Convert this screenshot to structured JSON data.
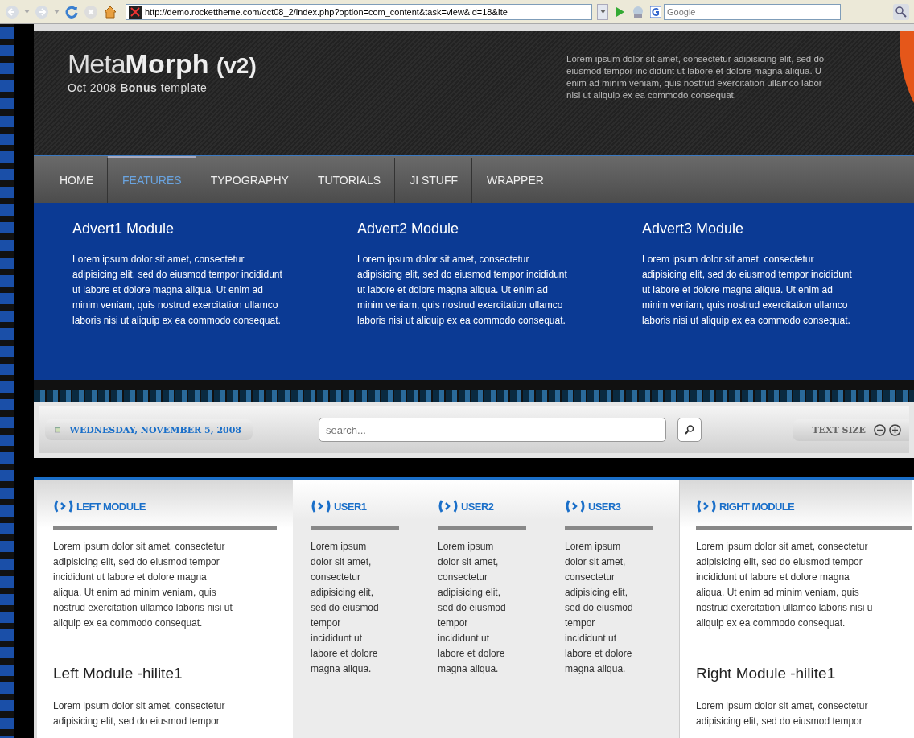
{
  "browser": {
    "address": "http://demo.rockettheme.com/oct08_2/index.php?option=com_content&task=view&id=18&Ite",
    "search_placeholder": "Google"
  },
  "header": {
    "logo_light": "Meta",
    "logo_bold": "Morph",
    "logo_version": "(v2)",
    "tagline": "Oct 2008 **Bonus** template",
    "intro_lines": [
      "Lorem ipsum dolor sit amet, consectetur adipisicing elit, sed do",
      "eiusmod tempor incididunt ut labore et dolore magna aliqua. U",
      "enim ad minim veniam, quis nostrud exercitation ullamco labor",
      "nisi ut aliquip ex ea commodo consequat."
    ]
  },
  "nav": [
    {
      "label": "HOME",
      "selected": false
    },
    {
      "label": "FEATURES",
      "selected": true
    },
    {
      "label": "TYPOGRAPHY",
      "selected": false
    },
    {
      "label": "TUTORIALS",
      "selected": false
    },
    {
      "label": "JI STUFF",
      "selected": false
    },
    {
      "label": "WRAPPER",
      "selected": false
    }
  ],
  "adverts": [
    {
      "title": "Advert1 Module",
      "text": "Lorem ipsum dolor sit amet, consectetur adipisicing elit, sed do eiusmod tempor incididunt ut labore et dolore magna aliqua. Ut enim ad minim veniam, quis nostrud exercitation ullamco laboris nisi ut aliquip ex ea commodo consequat."
    },
    {
      "title": "Advert2 Module",
      "text": "Lorem ipsum dolor sit amet, consectetur adipisicing elit, sed do eiusmod tempor incididunt ut labore et dolore magna aliqua. Ut enim ad minim veniam, quis nostrud exercitation ullamco laboris nisi ut aliquip ex ea commodo consequat."
    },
    {
      "title": "Advert3 Module",
      "text": "Lorem ipsum dolor sit amet, consectetur adipisicing elit, sed do eiusmod tempor incididunt ut labore et dolore magna aliqua. Ut enim ad minim veniam, quis nostrud exercitation ullamco laboris nisi ut aliquip ex ea commodo consequat."
    }
  ],
  "toolbar": {
    "date": "WEDNESDAY, NOVEMBER 5, 2008",
    "search_placeholder": "search...",
    "text_size": "TEXT SIZE"
  },
  "left_module": {
    "title": "LEFT MODULE",
    "lines": [
      "Lorem ipsum dolor sit amet, consectetur",
      "adipisicing elit, sed do eiusmod tempor",
      "incididunt ut labore et dolore magna",
      "aliqua. Ut enim ad minim veniam, quis",
      "nostrud exercitation ullamco laboris nisi ut",
      "aliquip ex ea commodo consequat."
    ],
    "subtitle": "Left Module -hilite1",
    "sub_lines": [
      "Lorem ipsum dolor sit amet, consectetur",
      "adipisicing elit, sed do eiusmod tempor"
    ]
  },
  "user_modules": [
    {
      "title": "USER1",
      "lines": [
        "Lorem ipsum",
        "dolor sit amet,",
        "consectetur",
        "adipisicing elit,",
        "sed do eiusmod",
        "tempor",
        "incididunt ut",
        "labore et dolore",
        "magna aliqua."
      ]
    },
    {
      "title": "USER2",
      "lines": [
        "Lorem ipsum",
        "dolor sit amet,",
        "consectetur",
        "adipisicing elit,",
        "sed do eiusmod",
        "tempor",
        "incididunt ut",
        "labore et dolore",
        "magna aliqua."
      ]
    },
    {
      "title": "USER3",
      "lines": [
        "Lorem ipsum",
        "dolor sit amet,",
        "consectetur",
        "adipisicing elit,",
        "sed do eiusmod",
        "tempor",
        "incididunt ut",
        "labore et dolore",
        "magna aliqua."
      ]
    }
  ],
  "right_module": {
    "title": "RIGHT MODULE",
    "lines": [
      "Lorem ipsum dolor sit amet, consectetur",
      "adipisicing elit, sed do eiusmod tempor",
      "incididunt ut labore et dolore magna",
      "aliqua. Ut enim ad minim veniam, quis",
      "nostrud exercitation ullamco laboris nisi u",
      "aliquip ex ea commodo consequat."
    ],
    "subtitle": "Right Module -hilite1",
    "sub_lines": [
      "Lorem ipsum dolor sit amet, consectetur",
      "adipisicing elit, sed do eiusmod tempor"
    ]
  }
}
